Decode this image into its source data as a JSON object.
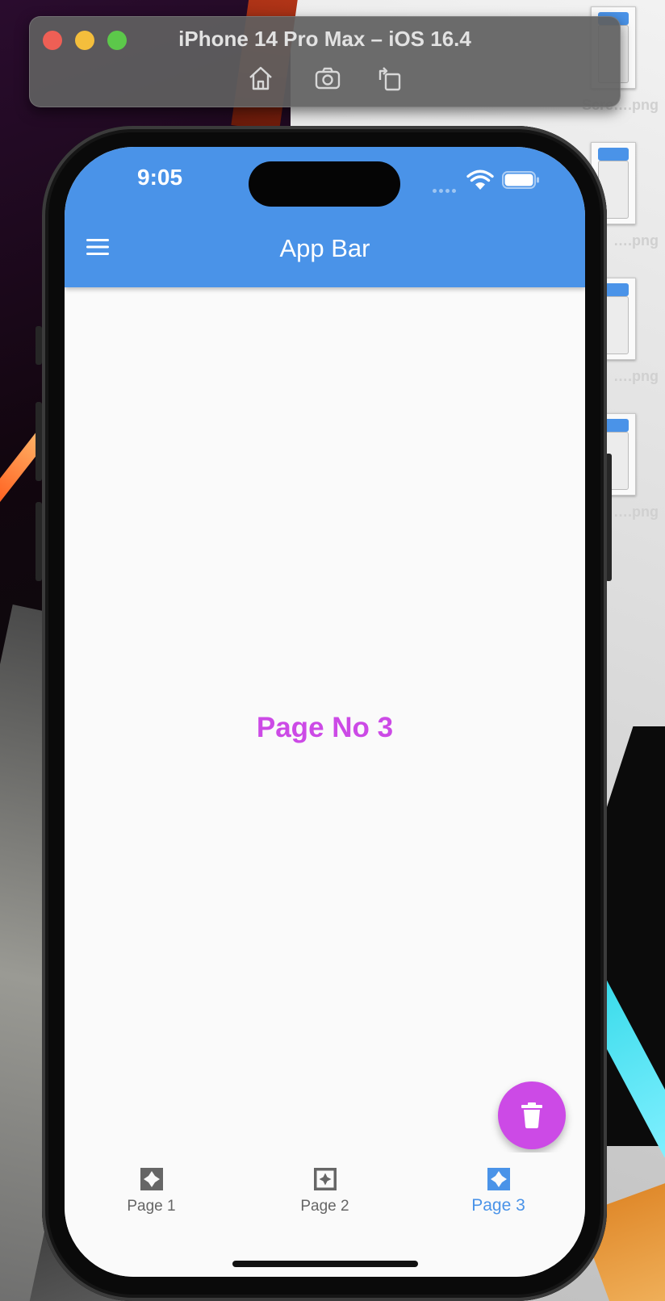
{
  "simulator": {
    "title": "iPhone 14 Pro Max – iOS 16.4",
    "tools": [
      "home-icon",
      "screenshot-icon",
      "rotate-icon"
    ]
  },
  "desktop": {
    "files": [
      {
        "name": "Scre….png"
      },
      {
        "name": "….png"
      },
      {
        "name": "….png"
      },
      {
        "name": "….png"
      }
    ]
  },
  "status_bar": {
    "time": "9:05"
  },
  "app_bar": {
    "title": "App Bar",
    "color": "#4a93e8"
  },
  "body": {
    "text": "Page No 3",
    "text_color": "#cc4ae6"
  },
  "fab": {
    "icon": "delete-icon",
    "color": "#cc4ae6"
  },
  "bottom_nav": {
    "items": [
      {
        "label": "Page 1",
        "active": false
      },
      {
        "label": "Page 2",
        "active": false
      },
      {
        "label": "Page 3",
        "active": true
      }
    ],
    "active_color": "#4a93e8",
    "inactive_color": "#666666"
  }
}
